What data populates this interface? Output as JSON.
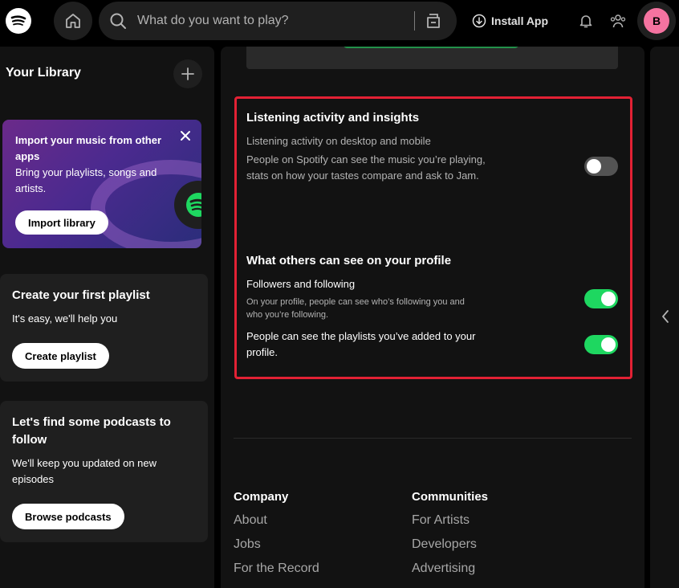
{
  "topbar": {
    "search_placeholder": "What do you want to play?",
    "install_label": "Install App",
    "avatar_initial": "B"
  },
  "sidebar": {
    "title": "Your Library",
    "import_card": {
      "title": "Import your music from other apps",
      "subtitle": "Bring your playlists, songs and artists.",
      "button": "Import library"
    },
    "playlist_card": {
      "title": "Create your first playlist",
      "subtitle": "It's easy, we'll help you",
      "button": "Create playlist"
    },
    "podcast_card": {
      "title": "Let's find some podcasts to follow",
      "subtitle": "We'll keep you updated on new episodes",
      "button": "Browse podcasts"
    }
  },
  "settings": {
    "listening": {
      "title": "Listening activity and insights",
      "label": "Listening activity on desktop and mobile",
      "description": "People on Spotify can see the music you’re playing, stats on how your tastes compare and ask to Jam.",
      "enabled": false
    },
    "profile": {
      "title": "What others can see on your profile",
      "followers_label": "Followers and following",
      "followers_desc": "On your profile, people can see who’s following you and who you’re following.",
      "followers_enabled": true,
      "playlists_label": "People can see the playlists you’ve added to your profile.",
      "playlists_enabled": true
    }
  },
  "footer": {
    "company": {
      "heading": "Company",
      "links": [
        "About",
        "Jobs",
        "For the Record"
      ]
    },
    "communities": {
      "heading": "Communities",
      "links": [
        "For Artists",
        "Developers",
        "Advertising"
      ]
    }
  },
  "colors": {
    "accent_green": "#1ed760",
    "highlight_red": "#e22134",
    "avatar_pink": "#f573a0"
  }
}
